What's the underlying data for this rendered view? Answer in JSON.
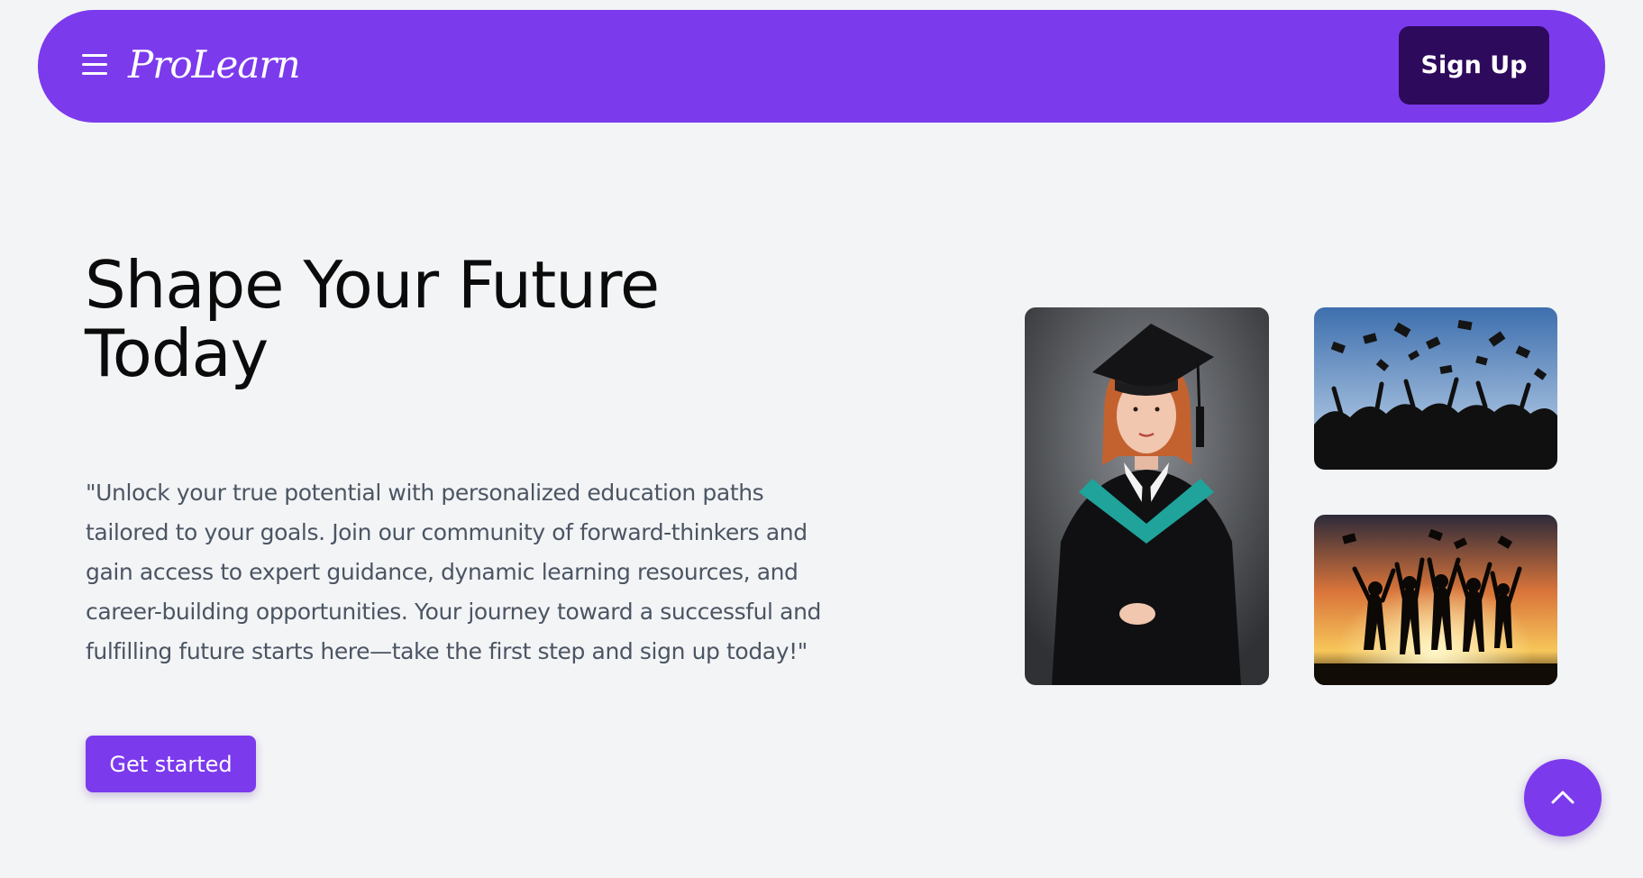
{
  "navbar": {
    "menu_icon": "hamburger-menu-icon",
    "logo": "ProLearn",
    "signup_label": "Sign Up"
  },
  "hero": {
    "title": "Shape Your Future Today",
    "description": "\"Unlock your true potential with personalized education paths tailored to your goals. Join our community of forward-thinkers and gain access to expert guidance, dynamic learning resources, and career-building opportunities. Your journey toward a successful and fulfilling future starts here—take the first step and sign up today!\"",
    "cta_label": "Get started"
  },
  "gallery": [
    {
      "subject": "graduate-portrait"
    },
    {
      "subject": "graduation-caps-toss"
    },
    {
      "subject": "graduates-sunset-silhouette"
    }
  ],
  "scroll_top": {
    "icon": "chevron-up-icon"
  },
  "colors": {
    "accent": "#7c3aed",
    "signup_bg": "#2e0a5c",
    "background": "#f3f4f6",
    "title_text": "#0b0b0b",
    "body_text": "#4b5563"
  }
}
